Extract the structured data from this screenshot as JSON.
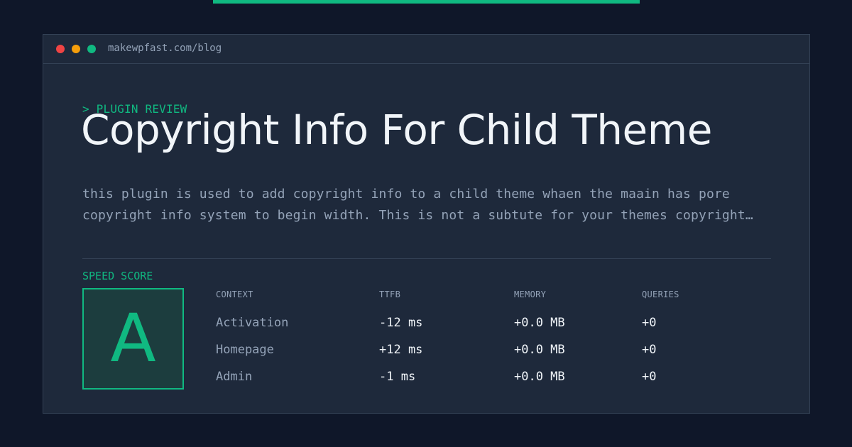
{
  "browser": {
    "url": "makewpfast.com/blog"
  },
  "article": {
    "kicker": "> PLUGIN REVIEW",
    "title": "Copyright Info For Child Theme",
    "description": "this plugin is used to add copyright info to a child theme whaen the maain has pore copyright info system to begin width. This is not a subtute for your themes copyright…"
  },
  "speed": {
    "label": "SPEED SCORE",
    "grade": "A"
  },
  "table": {
    "headers": [
      "CONTEXT",
      "TTFB",
      "MEMORY",
      "QUERIES"
    ],
    "rows": [
      {
        "context": "Activation",
        "ttfb": "-12 ms",
        "memory": "+0.0 MB",
        "queries": "+0"
      },
      {
        "context": "Homepage",
        "ttfb": "+12 ms",
        "memory": "+0.0 MB",
        "queries": "+0"
      },
      {
        "context": "Admin",
        "ttfb": "-1 ms",
        "memory": "+0.0 MB",
        "queries": "+0"
      }
    ]
  },
  "colors": {
    "accent": "#10b981",
    "background": "#0f1729",
    "panel": "#1e293b",
    "dot_red": "#ef4444",
    "dot_yellow": "#f59e0b",
    "dot_green": "#10b981"
  }
}
